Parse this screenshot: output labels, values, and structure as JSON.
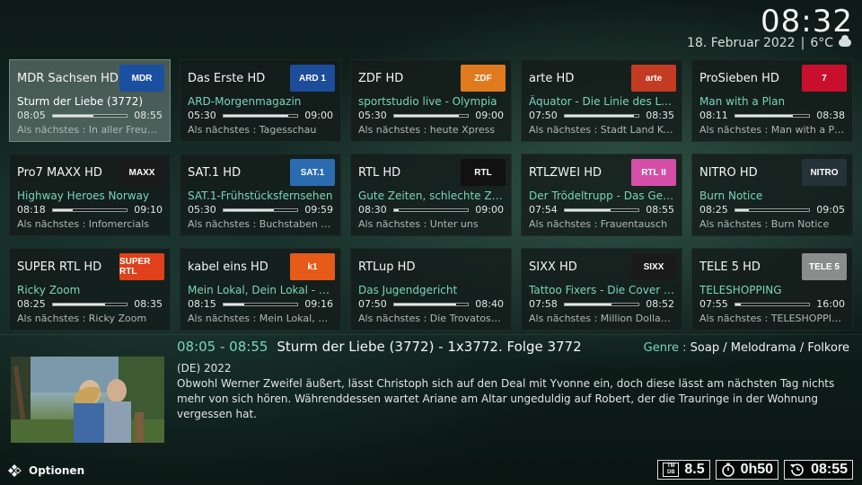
{
  "header": {
    "clock": "08:32",
    "date": "18. Februar 2022",
    "temperature": "6°C",
    "weather_icon": "cloud-icon"
  },
  "channels": [
    {
      "name": "MDR Sachsen HD",
      "logo": "MDR",
      "logo_bg": "#1b4fa0",
      "program": "Sturm der Liebe (3772)",
      "start": "08:05",
      "end": "08:55",
      "progress": 0.55,
      "next": "Als nächstes : In aller Freund...",
      "focused": true
    },
    {
      "name": "Das Erste HD",
      "logo": "ARD 1",
      "logo_bg": "#1d4c9a",
      "program": "ARD-Morgenmagazin",
      "start": "05:30",
      "end": "09:00",
      "progress": 0.87,
      "next": "Als nächstes : Tagesschau"
    },
    {
      "name": "ZDF HD",
      "logo": "ZDF",
      "logo_bg": "#e07a1f",
      "program": "sportstudio live - Olympia",
      "start": "05:30",
      "end": "09:00",
      "progress": 0.87,
      "next": "Als nächstes : heute Xpress"
    },
    {
      "name": "arte HD",
      "logo": "arte",
      "logo_bg": "#c23b22",
      "program": "Äquator - Die Linie des Leben...",
      "start": "07:50",
      "end": "08:35",
      "progress": 0.93,
      "next": "Als nächstes : Stadt Land Kunst"
    },
    {
      "name": "ProSieben HD",
      "logo": "7",
      "logo_bg": "#c8102e",
      "program": "Man with a Plan",
      "start": "08:11",
      "end": "08:38",
      "progress": 0.78,
      "next": "Als nächstes : Man with a Plan"
    },
    {
      "name": "Pro7 MAXX HD",
      "logo": "MAXX",
      "logo_bg": "#1a1a1a",
      "program": "Highway Heroes Norway",
      "start": "08:18",
      "end": "09:10",
      "progress": 0.27,
      "next": "Als nächstes : Infomercials"
    },
    {
      "name": "SAT.1 HD",
      "logo": "SAT.1",
      "logo_bg": "#2b6cb0",
      "program": "SAT.1-Frühstücksfernsehen",
      "start": "05:30",
      "end": "09:59",
      "progress": 0.68,
      "next": "Als nächstes : Buchstaben Bat..."
    },
    {
      "name": "RTL HD",
      "logo": "RTL",
      "logo_bg": "#111111",
      "program": "Gute Zeiten, schlechte Zeiten",
      "start": "08:30",
      "end": "09:00",
      "progress": 0.07,
      "next": "Als nächstes : Unter uns"
    },
    {
      "name": "RTLZWEI HD",
      "logo": "RTL II",
      "logo_bg": "#d44ea8",
      "program": "Der Trödeltrupp - Das Geld li...",
      "start": "07:54",
      "end": "08:55",
      "progress": 0.62,
      "next": "Als nächstes : Frauentausch"
    },
    {
      "name": "NITRO HD",
      "logo": "NITRO",
      "logo_bg": "#25323a",
      "program": "Burn Notice",
      "start": "08:25",
      "end": "09:05",
      "progress": 0.18,
      "next": "Als nächstes : Burn Notice"
    },
    {
      "name": "SUPER RTL HD",
      "logo": "SUPER RTL",
      "logo_bg": "#e0401a",
      "program": "Ricky Zoom",
      "start": "08:25",
      "end": "08:35",
      "progress": 0.7,
      "next": "Als nächstes : Ricky Zoom"
    },
    {
      "name": "kabel eins HD",
      "logo": "k1",
      "logo_bg": "#e65a1a",
      "program": "Mein Lokal, Dein Lokal - Der ...",
      "start": "08:15",
      "end": "09:16",
      "progress": 0.28,
      "next": "Als nächstes : Mein Lokal, Dei..."
    },
    {
      "name": "RTLup HD",
      "logo": "",
      "logo_bg": "transparent",
      "program": "Das Jugendgericht",
      "start": "07:50",
      "end": "08:40",
      "progress": 0.84,
      "next": "Als nächstes : Die Trovatos - ..."
    },
    {
      "name": "SIXX HD",
      "logo": "SIXX",
      "logo_bg": "#1a1a1a",
      "program": "Tattoo Fixers - Die Cover Up-...",
      "start": "07:58",
      "end": "08:52",
      "progress": 0.63,
      "next": "Als nächstes : Million Dollar H..."
    },
    {
      "name": "TELE 5 HD",
      "logo": "TELE 5",
      "logo_bg": "#8a8d8c",
      "program": "TELESHOPPING",
      "start": "07:55",
      "end": "16:00",
      "progress": 0.08,
      "next": "Als nächstes : TELESHOPPING"
    }
  ],
  "detail": {
    "time": "08:05 - 08:55",
    "title": "Sturm der Liebe (3772) - 1x3772. Folge 3772",
    "genre_label": "Genre :",
    "genre": "Soap / Melodrama / Folkore",
    "origin": "(DE) 2022",
    "description": "Obwohl Werner Zweifel äußert, lässt Christoph sich auf den Deal mit Yvonne ein, doch diese lässt am nächsten Tag nichts mehr von sich hören. Währenddessen wartet Ariane am Altar ungeduldig auf Robert, der die Trauringe in der Wohnung vergessen hat."
  },
  "footer": {
    "options_label": "Optionen",
    "rating": "8.5",
    "duration": "0h50",
    "end_time": "08:55"
  }
}
